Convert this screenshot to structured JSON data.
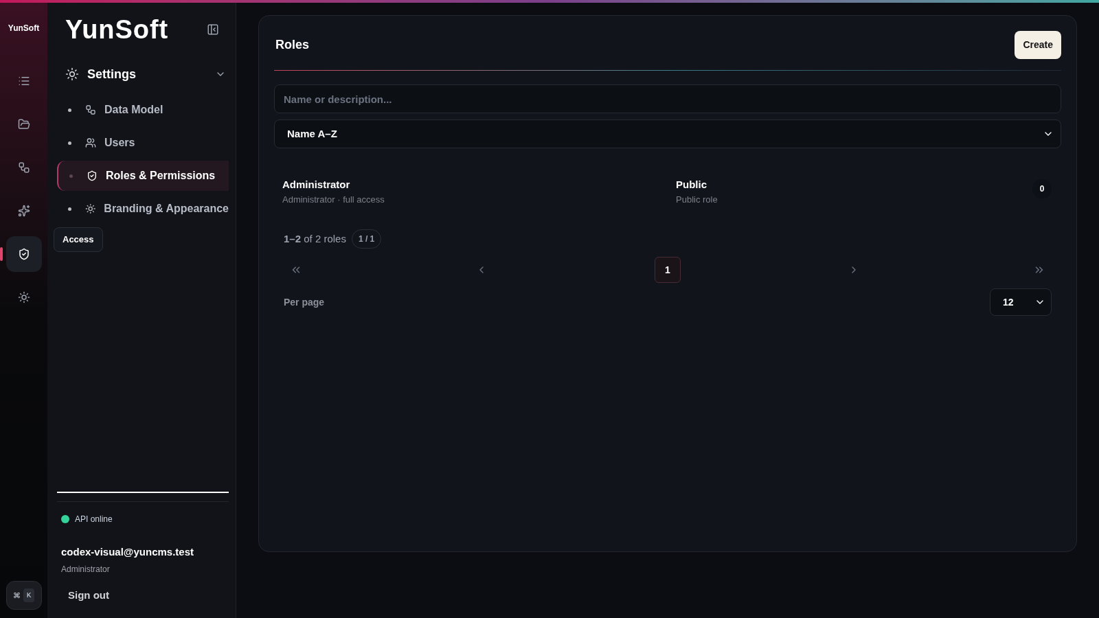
{
  "rail": {
    "brand": "YunSoft",
    "items": [
      {
        "kind": "list",
        "selected": false
      },
      {
        "kind": "folder",
        "selected": false
      },
      {
        "kind": "flow",
        "selected": false
      },
      {
        "kind": "sparkles",
        "selected": false
      },
      {
        "kind": "shield",
        "selected": true
      },
      {
        "kind": "sun",
        "selected": false
      }
    ],
    "tooltip": "Access",
    "shortcut": [
      "⌘",
      "K"
    ]
  },
  "sidebar": {
    "logo": "YunSoft",
    "section": {
      "label": "Settings",
      "expanded": true
    },
    "items": [
      {
        "label": "Data Model",
        "kind": "flow",
        "selected": false
      },
      {
        "label": "Users",
        "kind": "users",
        "selected": false
      },
      {
        "label": "Roles & Permissions",
        "kind": "shield",
        "selected": true
      },
      {
        "label": "Branding & Appearance",
        "kind": "sun",
        "selected": false
      }
    ],
    "status": {
      "label": "API online",
      "color": "#34d399"
    },
    "user": {
      "email": "codex-visual@yuncms.test",
      "role": "Administrator"
    },
    "sign_out": "Sign out"
  },
  "main": {
    "title": "Roles",
    "create": "Create",
    "search": {
      "placeholder": "Name or description..."
    },
    "sort": {
      "value": "Name A–Z"
    },
    "roles": [
      {
        "name": "Administrator",
        "description": "Administrator · full access"
      },
      {
        "name": "Public",
        "description": "Public role",
        "count": "0"
      }
    ],
    "summary": "**1–2** of 2 roles",
    "page_badge": "1 / 1",
    "pages": [
      {
        "label": "1",
        "selected": true
      }
    ],
    "per_page": {
      "label": "Per page",
      "value": "12"
    }
  }
}
